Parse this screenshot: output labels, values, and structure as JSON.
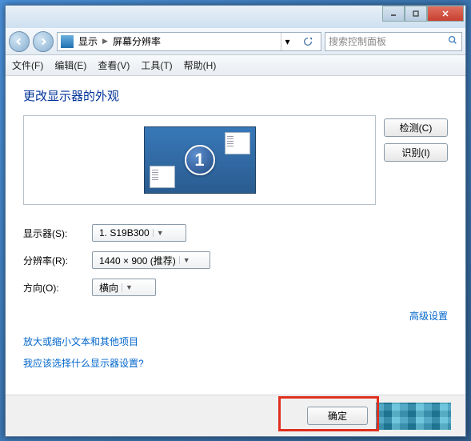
{
  "window": {
    "min_label": "_",
    "max_label": "▢",
    "close_label": "✕"
  },
  "breadcrumb": {
    "item1": "显示",
    "item2": "屏幕分辨率"
  },
  "search": {
    "placeholder": "搜索控制面板"
  },
  "menu": {
    "file": "文件(F)",
    "edit": "编辑(E)",
    "view": "查看(V)",
    "tools": "工具(T)",
    "help": "帮助(H)"
  },
  "heading": "更改显示器的外观",
  "monitor_number": "1",
  "buttons": {
    "detect": "检测(C)",
    "identify": "识别(I)",
    "ok": "确定"
  },
  "form": {
    "display_label": "显示器(S):",
    "display_value": "1. S19B300",
    "resolution_label": "分辨率(R):",
    "resolution_value": "1440 × 900 (推荐)",
    "orientation_label": "方向(O):",
    "orientation_value": "横向"
  },
  "links": {
    "advanced": "高级设置",
    "zoom_text": "放大或缩小文本和其他项目",
    "which_settings": "我应该选择什么显示器设置?"
  }
}
